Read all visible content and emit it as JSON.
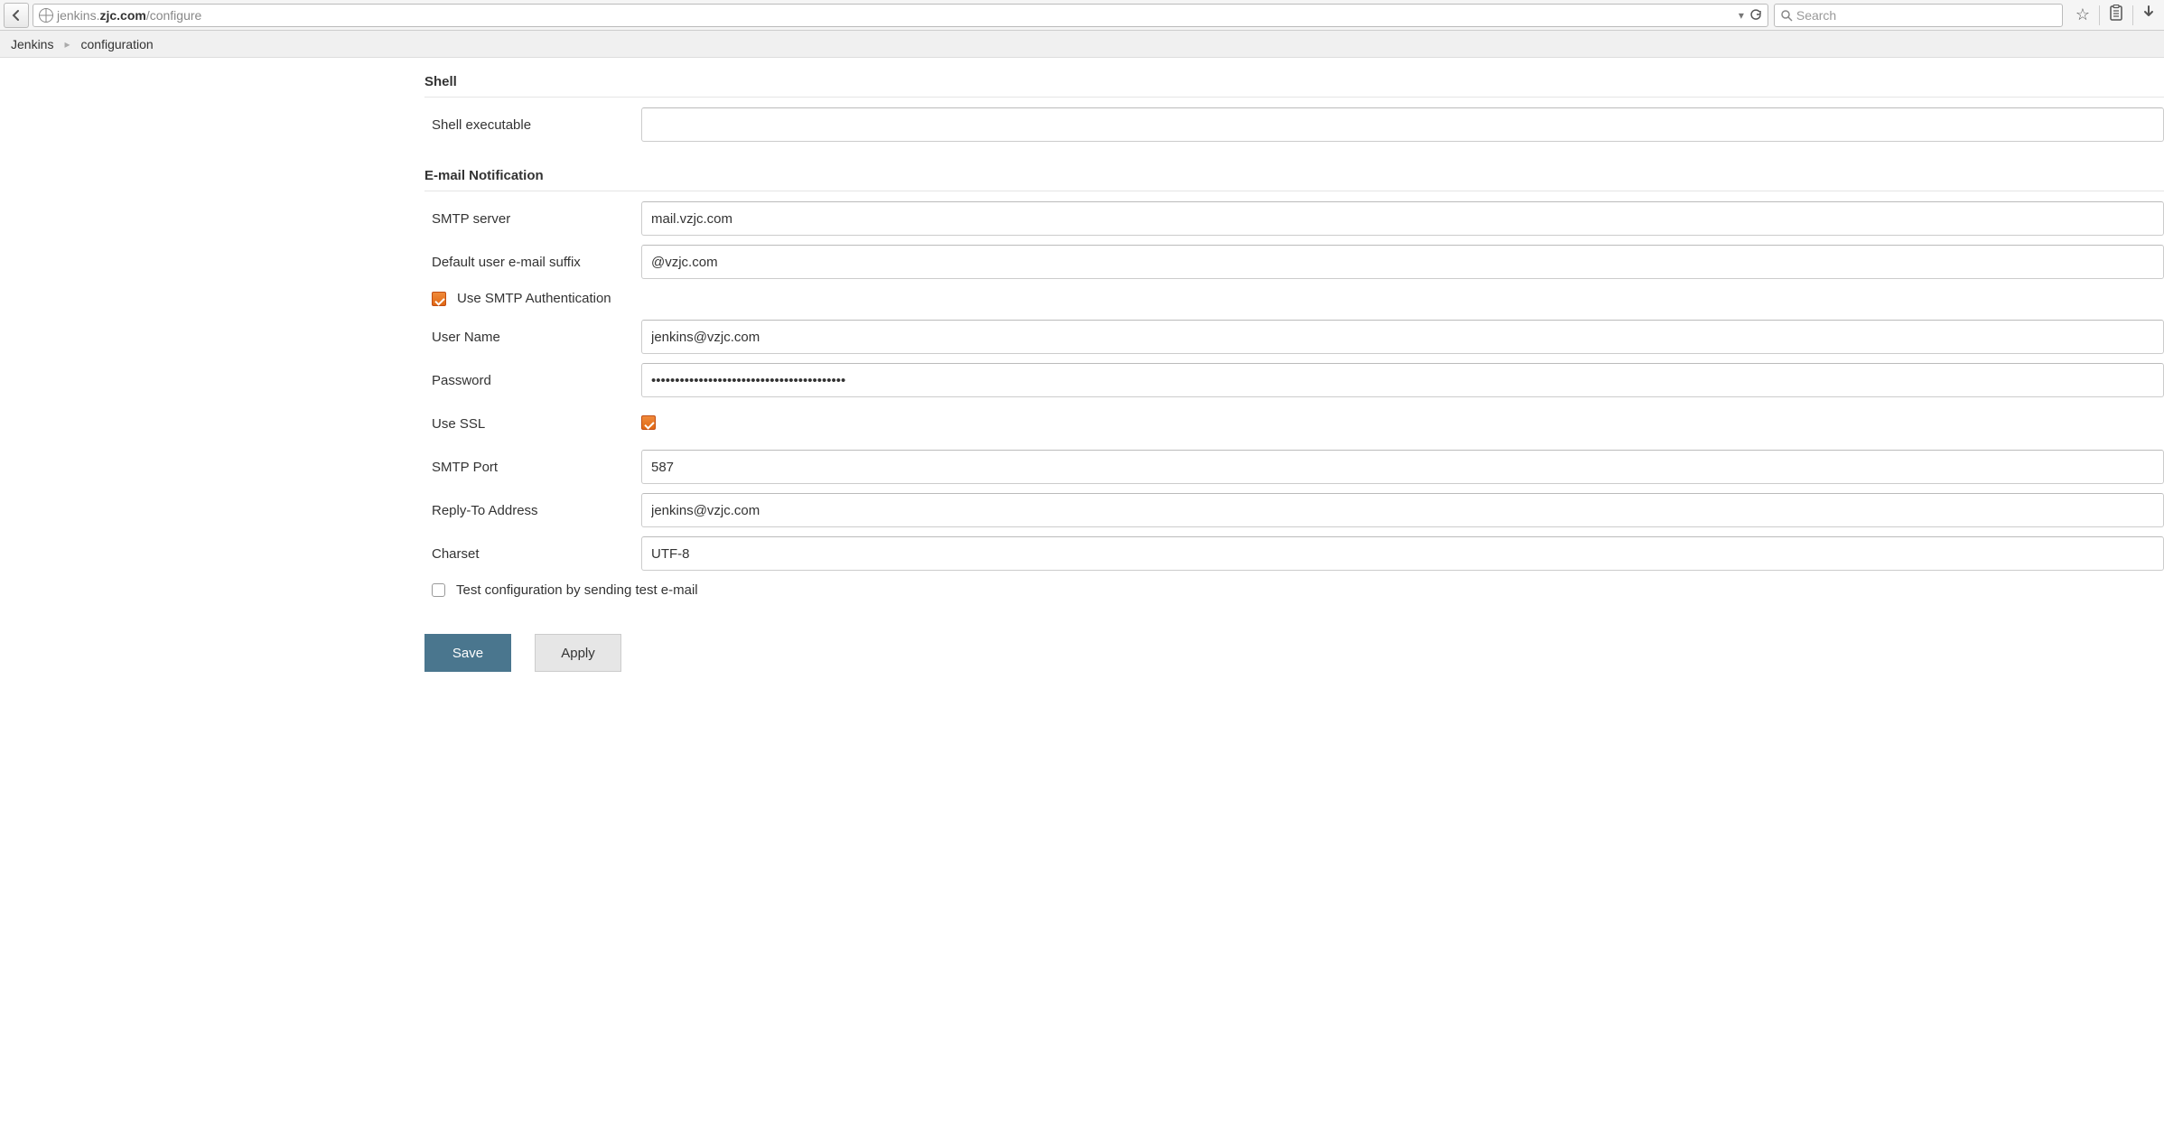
{
  "browser": {
    "url_domain_light1": "jenkins.",
    "url_domain_strong": "zjc.com",
    "url_path": "/configure",
    "search_placeholder": "Search"
  },
  "breadcrumb": {
    "root": "Jenkins",
    "current": "configuration"
  },
  "sections": {
    "shell_title": "Shell",
    "shell_exec_label": "Shell executable",
    "shell_exec_value": "",
    "email_title": "E-mail Notification",
    "smtp_server_label": "SMTP server",
    "smtp_server_value": "mail.vzjc.com",
    "suffix_label": "Default user e-mail suffix",
    "suffix_value": "@vzjc.com",
    "use_auth_label": "Use SMTP Authentication",
    "use_auth_checked": true,
    "username_label": "User Name",
    "username_value": "jenkins@vzjc.com",
    "password_label": "Password",
    "password_value": "*****************************************",
    "use_ssl_label": "Use SSL",
    "use_ssl_checked": true,
    "smtp_port_label": "SMTP Port",
    "smtp_port_value": "587",
    "reply_to_label": "Reply-To Address",
    "reply_to_value": "jenkins@vzjc.com",
    "charset_label": "Charset",
    "charset_value": "UTF-8",
    "test_config_label": "Test configuration by sending test e-mail",
    "test_config_checked": false
  },
  "buttons": {
    "save": "Save",
    "apply": "Apply"
  }
}
